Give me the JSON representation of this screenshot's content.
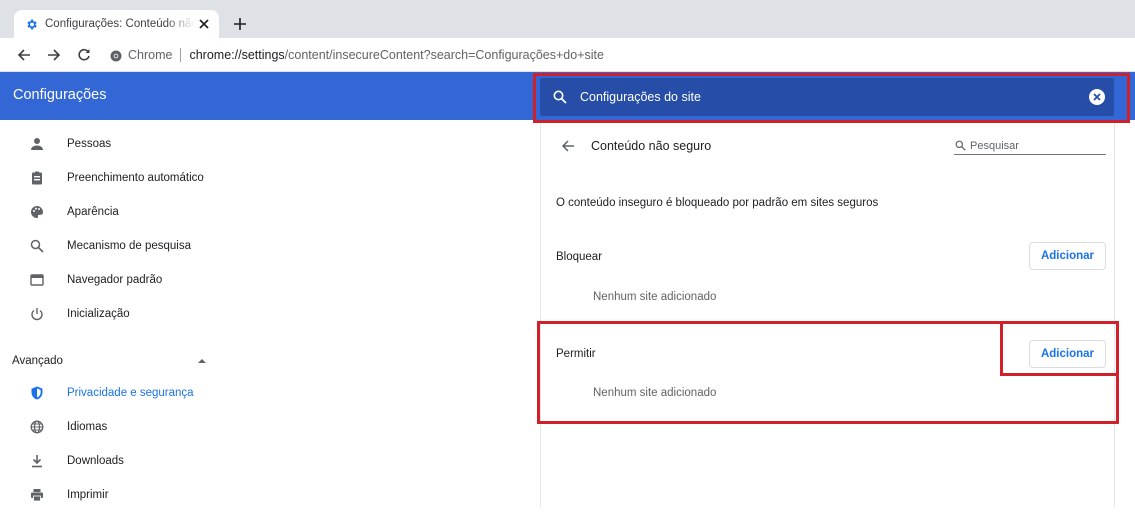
{
  "browser": {
    "tab_title": "Configurações: Conteúdo não seguro",
    "address": {
      "site_chip": "Chrome",
      "url_host": "chrome://settings",
      "url_path": "/content/insecureContent?search=Configurações+do+site"
    }
  },
  "header": {
    "title": "Configurações",
    "search_value": "Configurações do site"
  },
  "sidebar": {
    "items": [
      {
        "label": "Pessoas",
        "icon": "person-icon"
      },
      {
        "label": "Preenchimento automático",
        "icon": "clipboard-icon"
      },
      {
        "label": "Aparência",
        "icon": "palette-icon"
      },
      {
        "label": "Mecanismo de pesquisa",
        "icon": "search-icon"
      },
      {
        "label": "Navegador padrão",
        "icon": "browser-window-icon"
      },
      {
        "label": "Inicialização",
        "icon": "power-icon"
      }
    ],
    "advanced_label": "Avançado",
    "advanced_items": [
      {
        "label": "Privacidade e segurança",
        "icon": "shield-icon",
        "active": true
      },
      {
        "label": "Idiomas",
        "icon": "globe-icon"
      },
      {
        "label": "Downloads",
        "icon": "download-icon"
      },
      {
        "label": "Imprimir",
        "icon": "printer-icon"
      }
    ]
  },
  "main": {
    "title": "Conteúdo não seguro",
    "search_placeholder": "Pesquisar",
    "description": "O conteúdo inseguro é bloqueado por padrão em sites seguros",
    "block": {
      "label": "Bloquear",
      "add_label": "Adicionar",
      "empty_text": "Nenhum site adicionado"
    },
    "allow": {
      "label": "Permitir",
      "add_label": "Adicionar",
      "empty_text": "Nenhum site adicionado"
    }
  },
  "colors": {
    "header": "#3367d6",
    "search_bar": "#264ea8",
    "accent": "#1a73e8",
    "highlight": "#d0202a"
  }
}
